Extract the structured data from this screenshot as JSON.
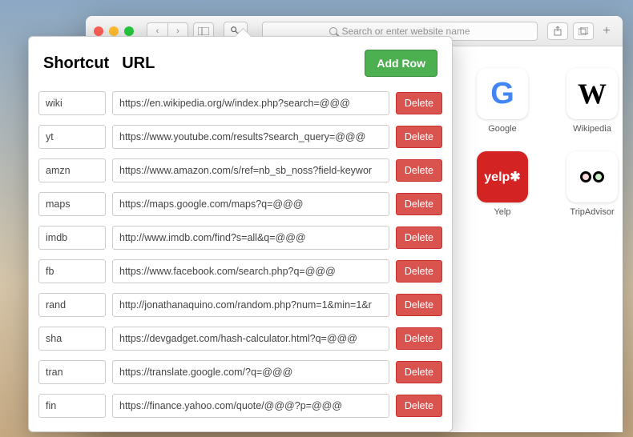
{
  "toolbar": {
    "search_placeholder": "Search or enter website name"
  },
  "popover": {
    "title1": "Shortcut",
    "title2": "URL",
    "add_row_label": "Add Row",
    "delete_label": "Delete",
    "rows": [
      {
        "shortcut": "wiki",
        "url": "https://en.wikipedia.org/w/index.php?search=@@@"
      },
      {
        "shortcut": "yt",
        "url": "https://www.youtube.com/results?search_query=@@@"
      },
      {
        "shortcut": "amzn",
        "url": "https://www.amazon.com/s/ref=nb_sb_noss?field-keywor"
      },
      {
        "shortcut": "maps",
        "url": "https://maps.google.com/maps?q=@@@"
      },
      {
        "shortcut": "imdb",
        "url": "http://www.imdb.com/find?s=all&q=@@@"
      },
      {
        "shortcut": "fb",
        "url": "https://www.facebook.com/search.php?q=@@@"
      },
      {
        "shortcut": "rand",
        "url": "http://jonathanaquino.com/random.php?num=1&min=1&r"
      },
      {
        "shortcut": "sha",
        "url": "https://devgadget.com/hash-calculator.html?q=@@@"
      },
      {
        "shortcut": "tran",
        "url": "https://translate.google.com/?q=@@@"
      },
      {
        "shortcut": "fin",
        "url": "https://finance.yahoo.com/quote/@@@?p=@@@"
      }
    ]
  },
  "favorites": [
    {
      "label": "Google"
    },
    {
      "label": "Wikipedia"
    },
    {
      "label": "Yelp"
    },
    {
      "label": "TripAdvisor"
    }
  ]
}
